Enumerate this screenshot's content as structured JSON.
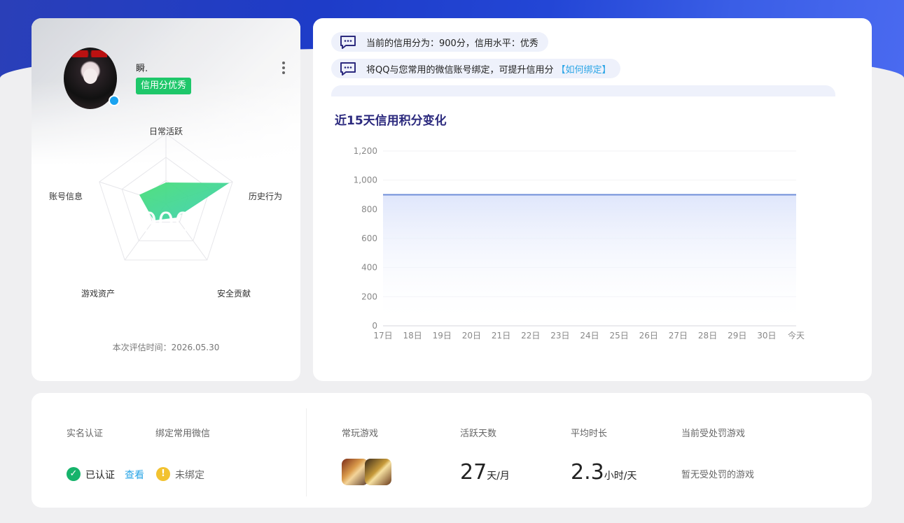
{
  "profile": {
    "username": "瞬.",
    "level_tag": "信用分优秀",
    "score": "900",
    "radar": {
      "axes": [
        "日常活跃",
        "历史行为",
        "安全贡献",
        "游戏资产",
        "账号信息"
      ],
      "values": [
        0.3,
        0.95,
        0.25,
        0.3,
        0.4
      ]
    },
    "eval_time": "本次评估时间：2026.05.30"
  },
  "tips": [
    {
      "text": "当前的信用分为：900分，信用水平：优秀",
      "link": ""
    },
    {
      "text": "将QQ与您常用的微信账号绑定，可提升信用分",
      "link": "【如何绑定】"
    }
  ],
  "chart_title": "近15天信用积分变化",
  "chart_data": {
    "type": "area",
    "title": "近15天信用积分变化",
    "categories": [
      "17日",
      "18日",
      "19日",
      "20日",
      "21日",
      "22日",
      "23日",
      "24日",
      "25日",
      "26日",
      "27日",
      "28日",
      "29日",
      "30日",
      "今天"
    ],
    "values": [
      900,
      900,
      900,
      900,
      900,
      900,
      900,
      900,
      900,
      900,
      900,
      900,
      900,
      900,
      900
    ],
    "ylim": [
      0,
      1200
    ],
    "yticks": [
      "0",
      "200",
      "400",
      "600",
      "800",
      "1,000",
      "1,200"
    ],
    "grid": true,
    "color": "#6f8ed8"
  },
  "stats": {
    "real_name_label": "实名认证",
    "wechat_label": "绑定常用微信",
    "verified_text": "已认证",
    "view_link": "查看",
    "unbound_text": "未绑定",
    "games_label": "常玩游戏",
    "active_days_label": "活跃天数",
    "active_days_value": "27",
    "active_days_unit": "天/月",
    "avg_time_label": "平均时长",
    "avg_time_value": "2.3",
    "avg_time_unit": "小时/天",
    "penalty_label": "当前受处罚游戏",
    "penalty_value": "暂无受处罚的游戏"
  },
  "colors": {
    "brand_blue": "#2346d6",
    "green": "#1ec76a",
    "link": "#2aa5e6",
    "title": "#2c2a7e"
  }
}
